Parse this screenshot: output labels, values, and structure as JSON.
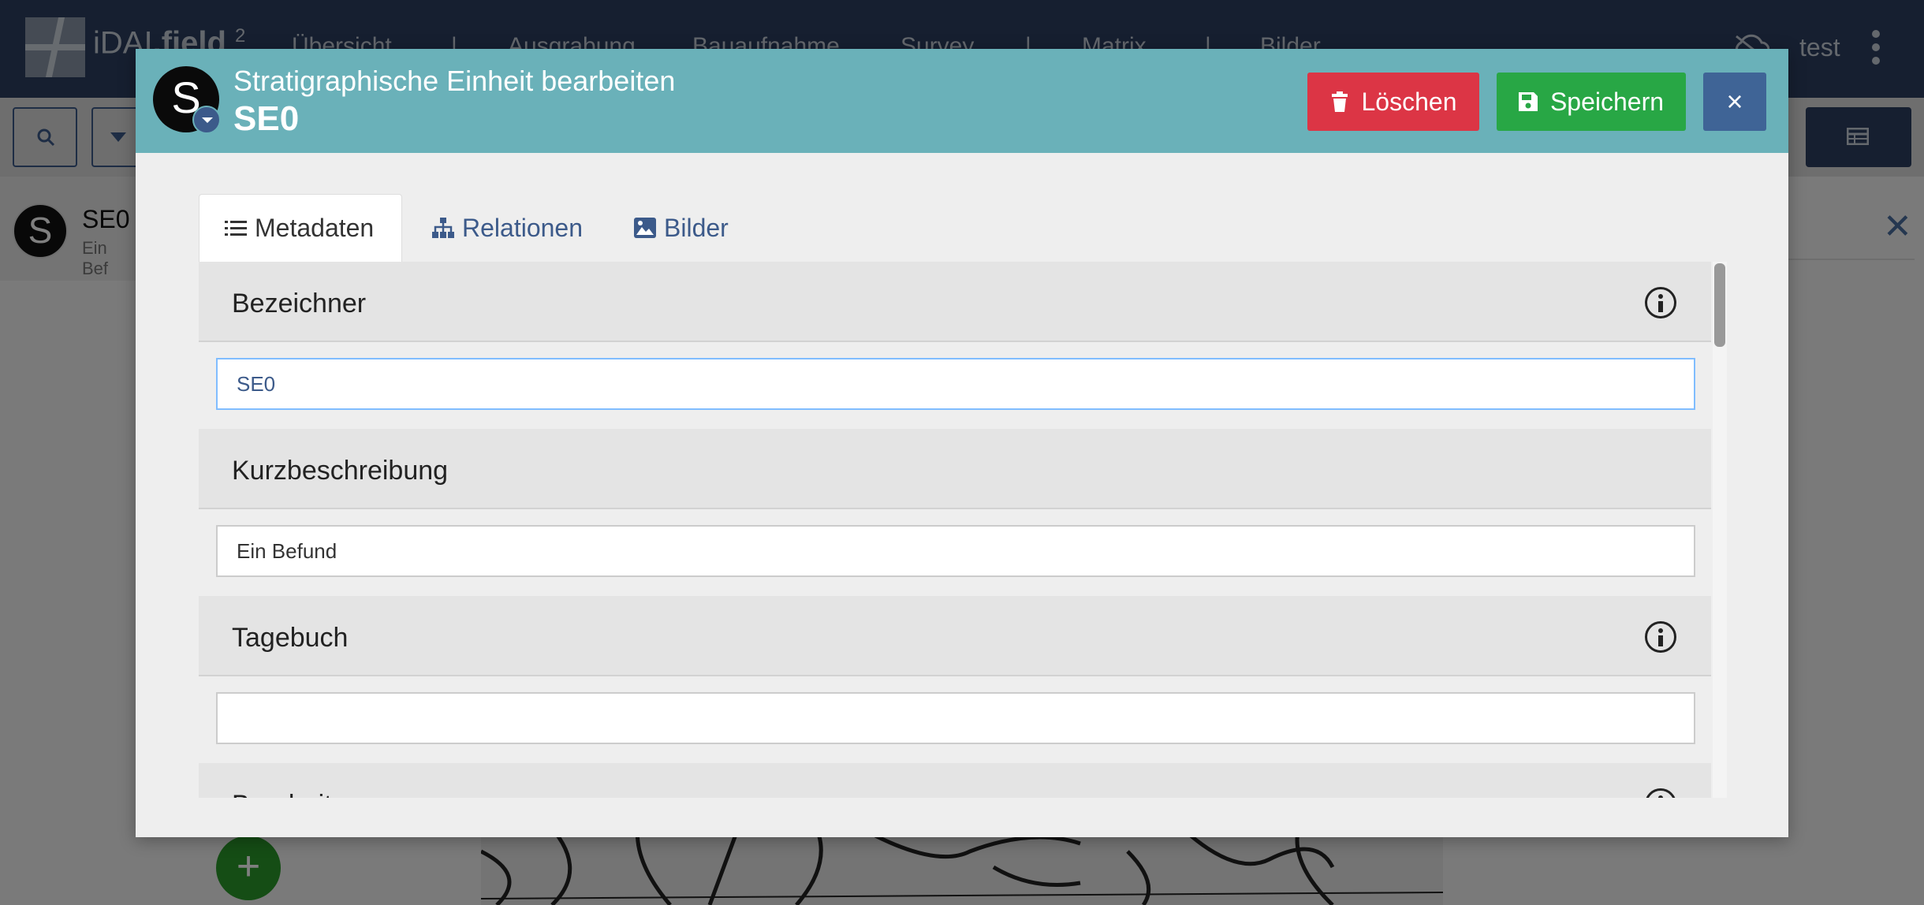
{
  "app": {
    "logo_text_light": "iDAI",
    "logo_text_bold": ".field",
    "logo_version": "2",
    "nav": [
      "Übersicht",
      "Ausgrabung",
      "Bauaufnahme",
      "Survey",
      "Matrix",
      "Bilder"
    ],
    "nav_separator": "|",
    "user": "test"
  },
  "list": {
    "item_avatar": "S",
    "item_title": "SE0",
    "item_subtitle": "Ein Bef"
  },
  "side_panel": {
    "link_fragment": "en"
  },
  "fab": {
    "label": "+"
  },
  "modal": {
    "avatar_letter": "S",
    "subtitle": "Stratigraphische Einheit bearbeiten",
    "title": "SE0",
    "delete_label": "Löschen",
    "save_label": "Speichern",
    "close_label": "×",
    "tabs": [
      {
        "label": "Metadaten",
        "icon": "list-icon",
        "active": true
      },
      {
        "label": "Relationen",
        "icon": "sitemap-icon",
        "active": false
      },
      {
        "label": "Bilder",
        "icon": "image-icon",
        "active": false
      }
    ],
    "fields": [
      {
        "label": "Bezeichner",
        "value": "SE0",
        "info": true
      },
      {
        "label": "Kurzbeschreibung",
        "value": "Ein Befund",
        "info": false
      },
      {
        "label": "Tagebuch",
        "value": "",
        "info": true
      },
      {
        "label": "Bearbeiter",
        "value": "",
        "info": true
      }
    ]
  },
  "colors": {
    "nav_bg": "#2c3e61",
    "header_bg": "#6ab1b9",
    "delete": "#dc3545",
    "save": "#28a745",
    "close": "#3f6496",
    "link": "#3c5a8a"
  }
}
